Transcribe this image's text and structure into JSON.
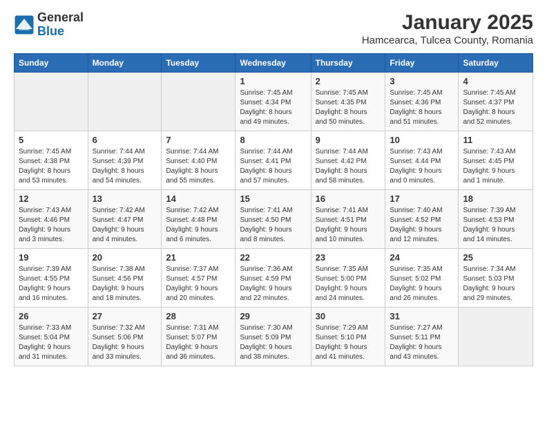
{
  "header": {
    "logo_general": "General",
    "logo_blue": "Blue",
    "title": "January 2025",
    "subtitle": "Hamcearca, Tulcea County, Romania"
  },
  "days_of_week": [
    "Sunday",
    "Monday",
    "Tuesday",
    "Wednesday",
    "Thursday",
    "Friday",
    "Saturday"
  ],
  "weeks": [
    [
      {
        "day": "",
        "info": ""
      },
      {
        "day": "",
        "info": ""
      },
      {
        "day": "",
        "info": ""
      },
      {
        "day": "1",
        "info": "Sunrise: 7:45 AM\nSunset: 4:34 PM\nDaylight: 8 hours\nand 49 minutes."
      },
      {
        "day": "2",
        "info": "Sunrise: 7:45 AM\nSunset: 4:35 PM\nDaylight: 8 hours\nand 50 minutes."
      },
      {
        "day": "3",
        "info": "Sunrise: 7:45 AM\nSunset: 4:36 PM\nDaylight: 8 hours\nand 51 minutes."
      },
      {
        "day": "4",
        "info": "Sunrise: 7:45 AM\nSunset: 4:37 PM\nDaylight: 8 hours\nand 52 minutes."
      }
    ],
    [
      {
        "day": "5",
        "info": "Sunrise: 7:45 AM\nSunset: 4:38 PM\nDaylight: 8 hours\nand 53 minutes."
      },
      {
        "day": "6",
        "info": "Sunrise: 7:44 AM\nSunset: 4:39 PM\nDaylight: 8 hours\nand 54 minutes."
      },
      {
        "day": "7",
        "info": "Sunrise: 7:44 AM\nSunset: 4:40 PM\nDaylight: 8 hours\nand 55 minutes."
      },
      {
        "day": "8",
        "info": "Sunrise: 7:44 AM\nSunset: 4:41 PM\nDaylight: 8 hours\nand 57 minutes."
      },
      {
        "day": "9",
        "info": "Sunrise: 7:44 AM\nSunset: 4:42 PM\nDaylight: 8 hours\nand 58 minutes."
      },
      {
        "day": "10",
        "info": "Sunrise: 7:43 AM\nSunset: 4:44 PM\nDaylight: 9 hours\nand 0 minutes."
      },
      {
        "day": "11",
        "info": "Sunrise: 7:43 AM\nSunset: 4:45 PM\nDaylight: 9 hours\nand 1 minute."
      }
    ],
    [
      {
        "day": "12",
        "info": "Sunrise: 7:43 AM\nSunset: 4:46 PM\nDaylight: 9 hours\nand 3 minutes."
      },
      {
        "day": "13",
        "info": "Sunrise: 7:42 AM\nSunset: 4:47 PM\nDaylight: 9 hours\nand 4 minutes."
      },
      {
        "day": "14",
        "info": "Sunrise: 7:42 AM\nSunset: 4:48 PM\nDaylight: 9 hours\nand 6 minutes."
      },
      {
        "day": "15",
        "info": "Sunrise: 7:41 AM\nSunset: 4:50 PM\nDaylight: 9 hours\nand 8 minutes."
      },
      {
        "day": "16",
        "info": "Sunrise: 7:41 AM\nSunset: 4:51 PM\nDaylight: 9 hours\nand 10 minutes."
      },
      {
        "day": "17",
        "info": "Sunrise: 7:40 AM\nSunset: 4:52 PM\nDaylight: 9 hours\nand 12 minutes."
      },
      {
        "day": "18",
        "info": "Sunrise: 7:39 AM\nSunset: 4:53 PM\nDaylight: 9 hours\nand 14 minutes."
      }
    ],
    [
      {
        "day": "19",
        "info": "Sunrise: 7:39 AM\nSunset: 4:55 PM\nDaylight: 9 hours\nand 16 minutes."
      },
      {
        "day": "20",
        "info": "Sunrise: 7:38 AM\nSunset: 4:56 PM\nDaylight: 9 hours\nand 18 minutes."
      },
      {
        "day": "21",
        "info": "Sunrise: 7:37 AM\nSunset: 4:57 PM\nDaylight: 9 hours\nand 20 minutes."
      },
      {
        "day": "22",
        "info": "Sunrise: 7:36 AM\nSunset: 4:59 PM\nDaylight: 9 hours\nand 22 minutes."
      },
      {
        "day": "23",
        "info": "Sunrise: 7:35 AM\nSunset: 5:00 PM\nDaylight: 9 hours\nand 24 minutes."
      },
      {
        "day": "24",
        "info": "Sunrise: 7:35 AM\nSunset: 5:02 PM\nDaylight: 9 hours\nand 26 minutes."
      },
      {
        "day": "25",
        "info": "Sunrise: 7:34 AM\nSunset: 5:03 PM\nDaylight: 9 hours\nand 29 minutes."
      }
    ],
    [
      {
        "day": "26",
        "info": "Sunrise: 7:33 AM\nSunset: 5:04 PM\nDaylight: 9 hours\nand 31 minutes."
      },
      {
        "day": "27",
        "info": "Sunrise: 7:32 AM\nSunset: 5:06 PM\nDaylight: 9 hours\nand 33 minutes."
      },
      {
        "day": "28",
        "info": "Sunrise: 7:31 AM\nSunset: 5:07 PM\nDaylight: 9 hours\nand 36 minutes."
      },
      {
        "day": "29",
        "info": "Sunrise: 7:30 AM\nSunset: 5:09 PM\nDaylight: 9 hours\nand 38 minutes."
      },
      {
        "day": "30",
        "info": "Sunrise: 7:29 AM\nSunset: 5:10 PM\nDaylight: 9 hours\nand 41 minutes."
      },
      {
        "day": "31",
        "info": "Sunrise: 7:27 AM\nSunset: 5:11 PM\nDaylight: 9 hours\nand 43 minutes."
      },
      {
        "day": "",
        "info": ""
      }
    ]
  ]
}
